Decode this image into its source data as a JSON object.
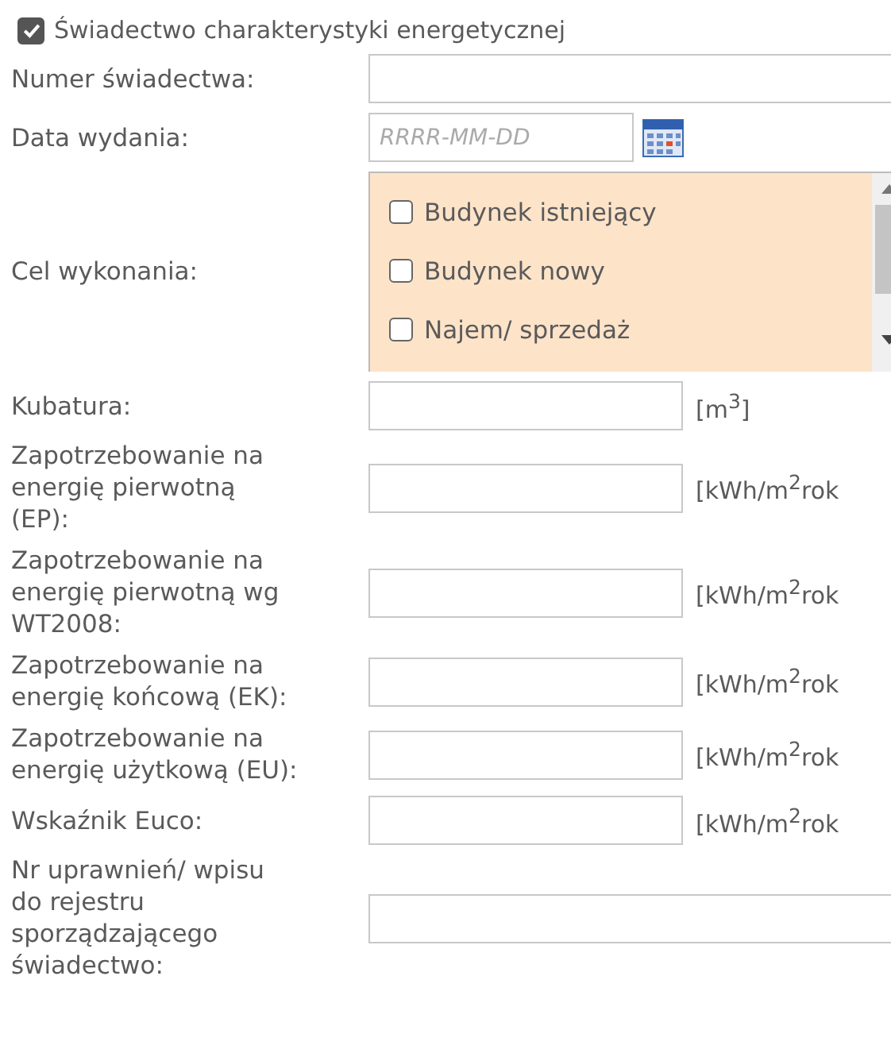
{
  "header": {
    "label": "Świadectwo charakterystyki energetycznej",
    "checked": true
  },
  "fields": [
    {
      "kind": "text",
      "label": "Numer świadectwa:"
    },
    {
      "kind": "date",
      "label": "Data wydania:",
      "placeholder": "RRRR-MM-DD"
    },
    {
      "kind": "checklist",
      "label": "Cel wykonania:",
      "options": [
        {
          "label": "Budynek istniejący",
          "checked": false
        },
        {
          "label": "Budynek nowy",
          "checked": false
        },
        {
          "label": "Najem/ sprzedaż",
          "checked": false
        }
      ]
    },
    {
      "kind": "unit",
      "label": "Kubatura:",
      "unit": "[m$^{3}$]"
    },
    {
      "kind": "unit",
      "label": "Zapotrzebowanie na\nenergię pierwotną\n(EP):",
      "unit": "[kWh/m$^{2}$rok"
    },
    {
      "kind": "unit",
      "label": "Zapotrzebowanie na\nenergię pierwotną wg\nWT2008:",
      "unit": "[kWh/m$^{2}$rok"
    },
    {
      "kind": "unit",
      "label": "Zapotrzebowanie na\nenergię końcową (EK):",
      "unit": "[kWh/m$^{2}$rok"
    },
    {
      "kind": "unit",
      "label": "Zapotrzebowanie na\nenergię użytkową (EU):",
      "unit": "[kWh/m$^{2}$rok"
    },
    {
      "kind": "unit",
      "label": "Wskaźnik Euco:",
      "unit": "[kWh/m$^{2}$rok"
    },
    {
      "kind": "text",
      "label": "Nr uprawnień/ wpisu\ndo rejestru\nsporządzającego\nświadectwo:"
    }
  ]
}
